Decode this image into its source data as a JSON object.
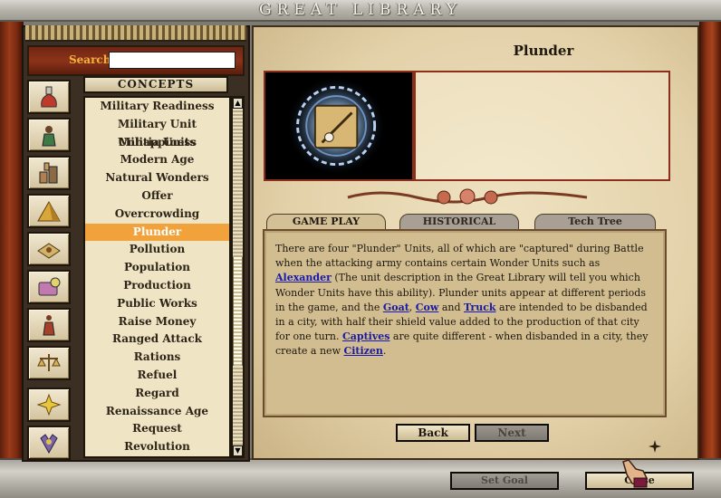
{
  "window": {
    "title": "GREAT LIBRARY"
  },
  "search": {
    "label": "Search",
    "value": ""
  },
  "concepts_header": "CONCEPTS",
  "sidebar_icons": [
    {
      "name": "advances-icon"
    },
    {
      "name": "improvements-icon"
    },
    {
      "name": "units-icon"
    },
    {
      "name": "wonders-icon"
    },
    {
      "name": "tile-improvements-icon"
    },
    {
      "name": "terrain-icon"
    },
    {
      "name": "concepts-icon"
    },
    {
      "name": "government-icon"
    },
    {
      "name": "goods-icon"
    },
    {
      "name": "shield-emblem-icon"
    }
  ],
  "concepts": [
    "Military Readiness",
    "Military Unit Unhappiness",
    "Militia Units",
    "Modern Age",
    "Natural Wonders",
    "Offer",
    "Overcrowding",
    "Plunder",
    "Pollution",
    "Population",
    "Production",
    "Public Works",
    "Raise Money",
    "Ranged Attack",
    "Rations",
    "Refuel",
    "Regard",
    "Renaissance Age",
    "Request",
    "Revolution"
  ],
  "selected_concept": "Plunder",
  "article": {
    "title": "Plunder",
    "tabs": [
      {
        "label": "GAME PLAY",
        "active": true
      },
      {
        "label": "HISTORICAL",
        "active": false
      },
      {
        "label": "Tech Tree",
        "active": false
      }
    ],
    "text": {
      "p1": "There are four \"Plunder\" Units, all of which are \"captured\" during Battle when the attacking army contains certain Wonder Units such as ",
      "link1": "Alexander",
      "p2": " (The unit description in the Great Library will tell you which Wonder Units have this ability). Plunder units appear at different periods in the game, and the ",
      "link2": "Goat",
      "p3": ", ",
      "link3": "Cow",
      "p4": " and ",
      "link4": "Truck",
      "p5": " are intended to be disbanded in a city, with half their shield value added to the production of that city for one turn. ",
      "link5": "Captives",
      "p6": " are quite different - when disbanded in a city, they create a new ",
      "link6": "Citizen",
      "p7": "."
    }
  },
  "nav": {
    "back_label": "Back",
    "next_label": "Next"
  },
  "bottom": {
    "set_goal_label": "Set Goal",
    "close_label": "Close"
  },
  "colors": {
    "selected_row": "#f2a23a",
    "link": "#1a1aa8",
    "search_label": "#f2b33b"
  }
}
